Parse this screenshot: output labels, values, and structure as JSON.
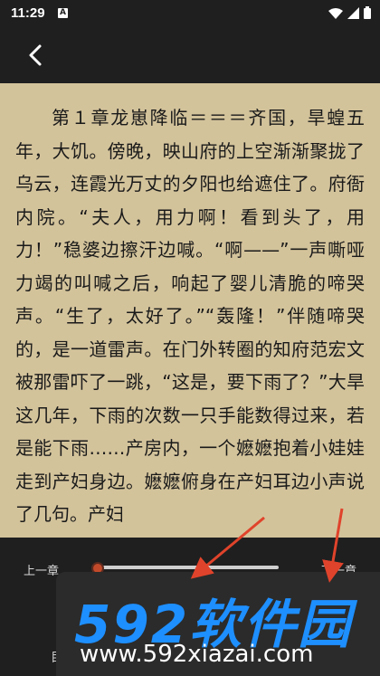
{
  "status": {
    "time": "11:29",
    "notification": "A"
  },
  "reader": {
    "text": "第１章龙崽降临＝＝＝齐国，旱蝗五年，大饥。傍晚，映山府的上空渐渐聚拢了乌云，连霞光万丈的夕阳也给遮住了。府衙内院。“夫人，用力啊！看到头了，用力！”稳婆边擦汗边喊。“啊——”一声嘶哑力竭的叫喊之后，响起了婴儿清脆的啼哭声。“生了，太好了。”“轰隆！”伴随啼哭的，是一道雷声。在门外转圈的知府范宏文被那雷吓了一跳，“这是，要下雨了？”大旱这几年，下雨的次数一只手能数得过来，若是能下雨……产房内，一个嬷嬷抱着小娃娃走到产妇身边。嬷嬷俯身在产妇耳边小声说了几句。产妇"
  },
  "controls": {
    "prev_label": "上一章",
    "next_label": "下一章",
    "progress": 0.0,
    "left_fragment": "目"
  },
  "watermark": {
    "logo": "592软件园",
    "url": "www.592xiazai.com"
  },
  "colors": {
    "accent": "#1e8fff",
    "arrow": "#e0432b",
    "page": "#d3c39b"
  }
}
